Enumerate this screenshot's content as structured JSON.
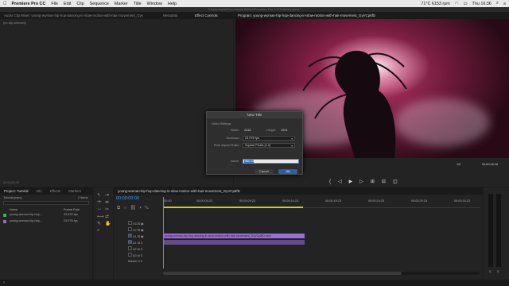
{
  "menubar": {
    "app": "Premiere Pro CC",
    "items": [
      "File",
      "Edit",
      "Clip",
      "Sequence",
      "Marker",
      "Title",
      "Window",
      "Help"
    ],
    "status": "71°C 6153 rpm",
    "clock": "Thu 16:36"
  },
  "path": "/Users/apple/Documents/Skilled/Premiere Pro 7-2/Tutorial.prproj *",
  "source": {
    "tabs": [
      "Audio Clip Mixer: young-woman-hip-hop-dancing-in-slow-motion-with-hair-movement_GyVCp8fD",
      "Metadata"
    ],
    "no_clip": "(no clip selected)",
    "timecode": "00:00:00:00"
  },
  "effect_controls": {
    "tab": "Effect Controls"
  },
  "program": {
    "tab": "Program: young-woman-hip-hop-dancing-in-slow-motion-with-hair-movement_GyVCp8fD",
    "fraction": "1/2",
    "duration": "00:00:16:16"
  },
  "dialog": {
    "title": "New Title",
    "section": "Video Settings",
    "width_label": "Width:",
    "width": "2048",
    "height_label": "Height:",
    "height": "1024",
    "timebase_label": "Timebase:",
    "timebase": "23.976 fps",
    "par_label": "Pixel Aspect Ratio:",
    "par": "Square Pixels (1.0)",
    "name_label": "Name:",
    "name": "Title 02",
    "cancel": "Cancel",
    "ok": "OK"
  },
  "project": {
    "tabs": [
      "Project: Tutorial",
      "Info",
      "Effects",
      "Markers"
    ],
    "project_file": "Tutorial.prproj",
    "count": "2 Items",
    "col_name": "Name",
    "col_fps": "Frame Rate",
    "items": [
      {
        "name": "young-woman-hip-hop...",
        "fps": "23.976 fps",
        "color": "#3cb04a"
      },
      {
        "name": "young-woman-hip-hop...",
        "fps": "23.976 fps",
        "color": "#8e65d6"
      }
    ]
  },
  "timeline": {
    "tab": "young-woman-hip-hop-dancing-in-slow-motion-with-hair-movement_GyVCp8fD",
    "timecode": "00:00:00:00",
    "ruler": [
      ":00:00",
      "00:00:04:23",
      "00:00:09:23",
      "00:00:14:23",
      "00:00:19:23",
      "00:00:24:23",
      "00:00:29:23",
      "00:00:34:23"
    ],
    "tracks_video": [
      "V3",
      "V2",
      "V1"
    ],
    "tracks_audio": [
      "A1",
      "A2",
      "A3"
    ],
    "master": "Master",
    "master_val": "0.0",
    "clip": "young-woman-hip-hop-dancing-in-slow-motion-with-hair-movement_GyVCp8fD.mov",
    "clip_color": "#9a6fd8"
  },
  "meters": {
    "s1": "S",
    "s2": "S"
  }
}
